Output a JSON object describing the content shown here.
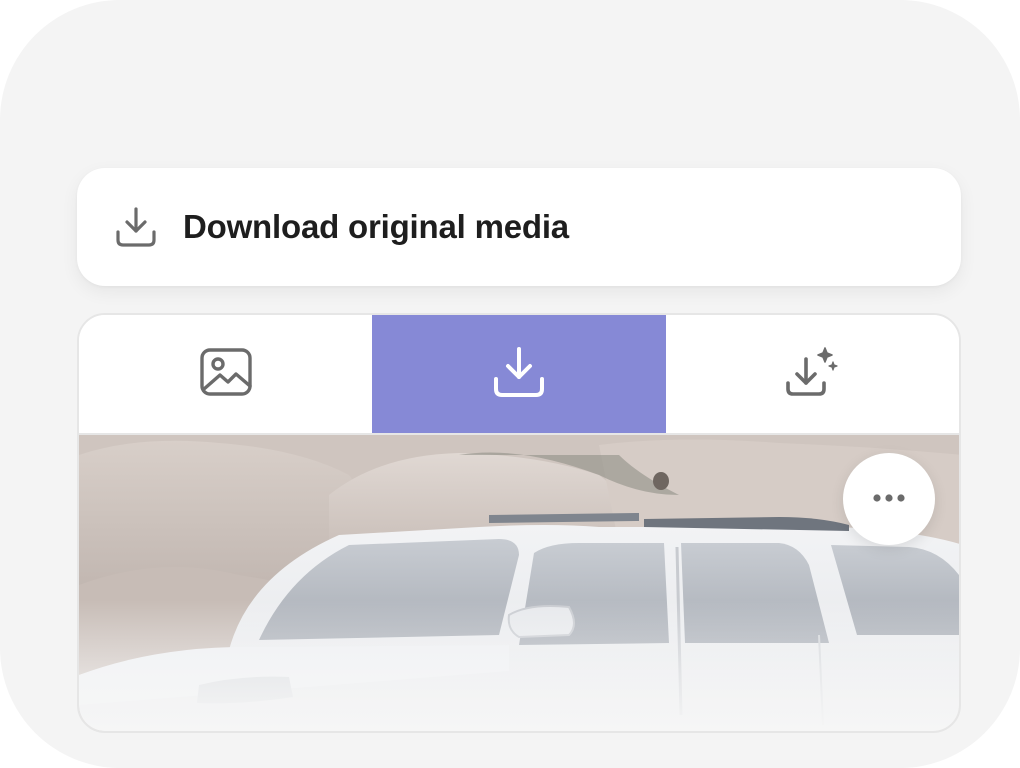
{
  "download_option": {
    "label": "Download original media",
    "icon": "download-tray-icon"
  },
  "segmented_control": {
    "tabs": [
      {
        "icon": "image-icon",
        "active": false
      },
      {
        "icon": "download-icon",
        "active": true
      },
      {
        "icon": "download-sparkle-icon",
        "active": false
      }
    ],
    "active_color": "#8689d6"
  },
  "media": {
    "more_icon": "more-horizontal-icon"
  },
  "colors": {
    "background": "#f4f4f4",
    "text": "#1e1e1e",
    "icon": "#6b6b6b",
    "active_tab": "#8689d6"
  }
}
